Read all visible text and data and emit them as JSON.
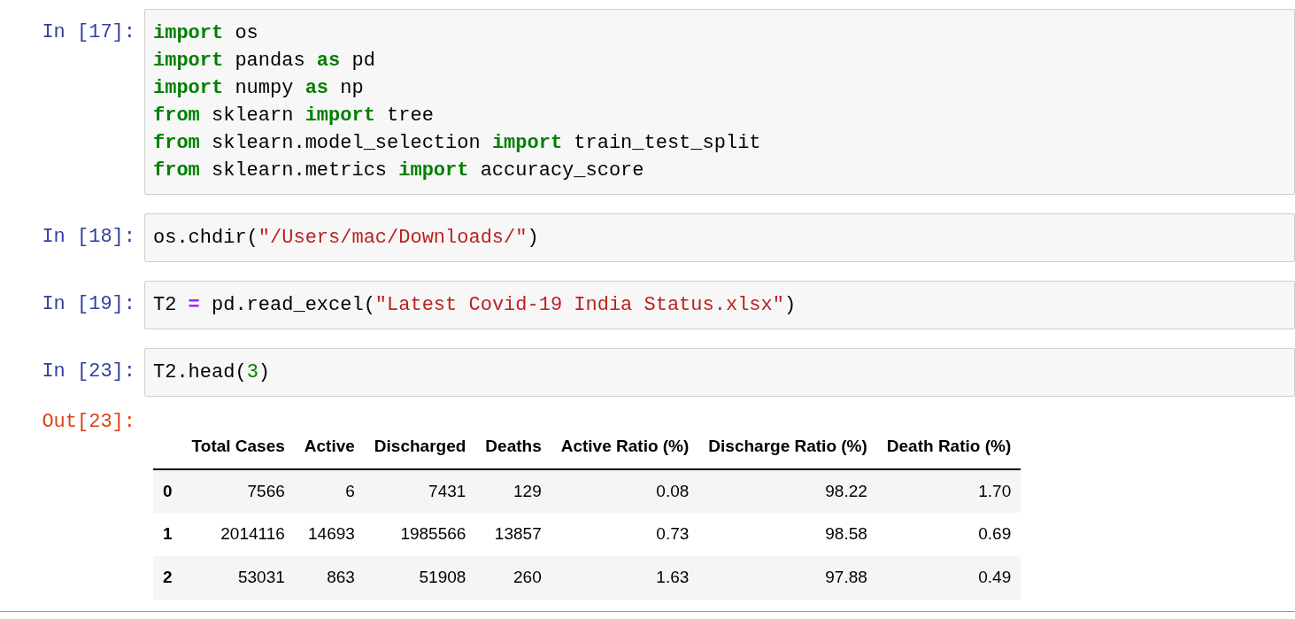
{
  "cells": [
    {
      "prompt": "In [17]:",
      "lines": [
        [
          {
            "text": "import",
            "kind": "kw"
          },
          {
            "text": " os",
            "kind": "plain"
          }
        ],
        [
          {
            "text": "import",
            "kind": "kw"
          },
          {
            "text": " pandas ",
            "kind": "plain"
          },
          {
            "text": "as",
            "kind": "kw"
          },
          {
            "text": " pd",
            "kind": "plain"
          }
        ],
        [
          {
            "text": "import",
            "kind": "kw"
          },
          {
            "text": " numpy ",
            "kind": "plain"
          },
          {
            "text": "as",
            "kind": "kw"
          },
          {
            "text": " np",
            "kind": "plain"
          }
        ],
        [
          {
            "text": "from",
            "kind": "kw"
          },
          {
            "text": " sklearn ",
            "kind": "plain"
          },
          {
            "text": "import",
            "kind": "kw"
          },
          {
            "text": " tree",
            "kind": "plain"
          }
        ],
        [
          {
            "text": "from",
            "kind": "kw"
          },
          {
            "text": " sklearn.model_selection ",
            "kind": "plain"
          },
          {
            "text": "import",
            "kind": "kw"
          },
          {
            "text": " train_test_split",
            "kind": "plain"
          }
        ],
        [
          {
            "text": "from",
            "kind": "kw"
          },
          {
            "text": " sklearn.metrics ",
            "kind": "plain"
          },
          {
            "text": "import",
            "kind": "kw"
          },
          {
            "text": " accuracy_score",
            "kind": "plain"
          }
        ]
      ]
    },
    {
      "prompt": "In [18]:",
      "lines": [
        [
          {
            "text": "os.chdir(",
            "kind": "plain"
          },
          {
            "text": "\"/Users/mac/Downloads/\"",
            "kind": "str"
          },
          {
            "text": ")",
            "kind": "plain"
          }
        ]
      ]
    },
    {
      "prompt": "In [19]:",
      "lines": [
        [
          {
            "text": "T2 ",
            "kind": "plain"
          },
          {
            "text": "=",
            "kind": "op"
          },
          {
            "text": " pd.read_excel(",
            "kind": "plain"
          },
          {
            "text": "\"Latest Covid-19 India Status.xlsx\"",
            "kind": "str"
          },
          {
            "text": ")",
            "kind": "plain"
          }
        ]
      ]
    },
    {
      "prompt": "In [23]:",
      "lines": [
        [
          {
            "text": "T2.head(",
            "kind": "plain"
          },
          {
            "text": "3",
            "kind": "num"
          },
          {
            "text": ")",
            "kind": "plain"
          }
        ]
      ]
    }
  ],
  "output": {
    "prompt": "Out[23]:",
    "table": {
      "columns": [
        "Total Cases",
        "Active",
        "Discharged",
        "Deaths",
        "Active Ratio (%)",
        "Discharge Ratio (%)",
        "Death Ratio (%)"
      ],
      "rows": [
        {
          "index": "0",
          "cells": [
            "7566",
            "6",
            "7431",
            "129",
            "0.08",
            "98.22",
            "1.70"
          ]
        },
        {
          "index": "1",
          "cells": [
            "2014116",
            "14693",
            "1985566",
            "13857",
            "0.73",
            "98.58",
            "0.69"
          ]
        },
        {
          "index": "2",
          "cells": [
            "53031",
            "863",
            "51908",
            "260",
            "1.63",
            "97.88",
            "0.49"
          ]
        }
      ]
    }
  }
}
